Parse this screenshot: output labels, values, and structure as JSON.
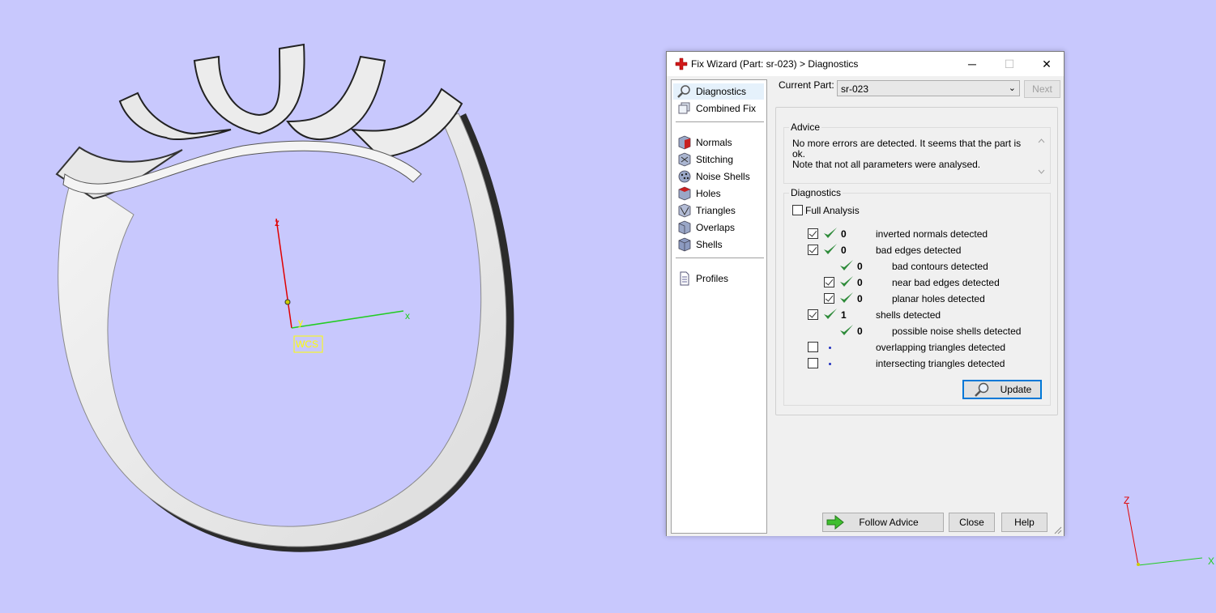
{
  "viewport": {
    "background": "#c8c8fd",
    "axes": {
      "z_label": "z",
      "y_label": "y",
      "x_label": "x",
      "wcs_label": "WCS"
    },
    "mini_axes": {
      "z_label": "Z",
      "x_label": "X"
    }
  },
  "dialog": {
    "title": "Fix Wizard (Part: sr-023) > Diagnostics",
    "title_icon": "red-cross-icon",
    "window_buttons": {
      "minimize": "─",
      "maximize": "☐",
      "close": "✕"
    },
    "nav": {
      "items_top": [
        {
          "label": "Diagnostics",
          "icon": "magnifier-icon",
          "selected": true
        },
        {
          "label": "Combined Fix",
          "icon": "combined-fix-icon"
        }
      ],
      "items_mid": [
        {
          "label": "Normals",
          "icon": "normals-icon"
        },
        {
          "label": "Stitching",
          "icon": "stitching-icon"
        },
        {
          "label": "Noise Shells",
          "icon": "noise-shells-icon"
        },
        {
          "label": "Holes",
          "icon": "holes-icon"
        },
        {
          "label": "Triangles",
          "icon": "triangles-icon"
        },
        {
          "label": "Overlaps",
          "icon": "overlaps-icon"
        },
        {
          "label": "Shells",
          "icon": "shells-icon"
        }
      ],
      "items_bottom": [
        {
          "label": "Profiles",
          "icon": "document-icon"
        }
      ]
    },
    "current_part_label": "Current Part:",
    "current_part_value": "sr-023",
    "next_label": "Next",
    "advice": {
      "title": "Advice",
      "line1": "No more errors are detected. It seems that the part is ok.",
      "line2": "Note that not all parameters were analysed."
    },
    "diagnostics": {
      "title": "Diagnostics",
      "full_analysis_label": "Full Analysis",
      "full_analysis_checked": false,
      "rows": [
        {
          "checkbox": true,
          "checked": true,
          "status": "ok",
          "count": "0",
          "label": "inverted normals detected",
          "indent": 0
        },
        {
          "checkbox": true,
          "checked": true,
          "status": "ok",
          "count": "0",
          "label": "bad edges detected",
          "indent": 0
        },
        {
          "checkbox": false,
          "checked": false,
          "status": "ok",
          "count": "0",
          "label": "bad contours detected",
          "indent": 1
        },
        {
          "checkbox": true,
          "checked": true,
          "status": "ok",
          "count": "0",
          "label": "near bad edges detected",
          "indent": 1
        },
        {
          "checkbox": true,
          "checked": true,
          "status": "ok",
          "count": "0",
          "label": "planar holes detected",
          "indent": 1
        },
        {
          "checkbox": true,
          "checked": true,
          "status": "ok",
          "count": "1",
          "label": "shells detected",
          "indent": 0
        },
        {
          "checkbox": false,
          "checked": false,
          "status": "ok",
          "count": "0",
          "label": "possible noise shells detected",
          "indent": 1
        },
        {
          "checkbox": true,
          "checked": false,
          "status": "pending",
          "count": "",
          "label": "overlapping triangles detected",
          "indent": 0
        },
        {
          "checkbox": true,
          "checked": false,
          "status": "pending",
          "count": "",
          "label": "intersecting triangles detected",
          "indent": 0
        }
      ]
    },
    "update_label": "Update",
    "follow_advice_label": "Follow Advice",
    "close_label": "Close",
    "help_label": "Help",
    "colors": {
      "accent": "#0078d7",
      "ok_tick": "#2e8b3a",
      "pending_dot": "#1f2fbf"
    }
  }
}
